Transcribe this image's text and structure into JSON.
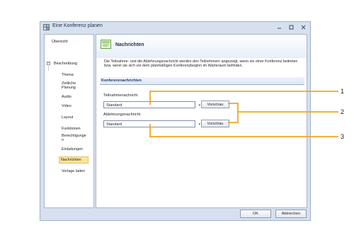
{
  "window": {
    "title": "Eine Konferenz planen"
  },
  "sidebar": {
    "items": [
      {
        "label": "Übersicht"
      },
      {
        "label": "Beschreibung"
      },
      {
        "label": "Thema"
      },
      {
        "label": "Zeitliche Planung"
      },
      {
        "label": "Audio"
      },
      {
        "label": "Video"
      },
      {
        "label": "Layout"
      },
      {
        "label": "Funktionen"
      },
      {
        "label": "Berechtigungen"
      },
      {
        "label": "Einladungen"
      },
      {
        "label": "Nachrichten"
      },
      {
        "label": "Vorlage laden"
      }
    ],
    "selected": "Nachrichten"
  },
  "panel": {
    "title": "Nachrichten",
    "description": "Die Teilnahme- und die Ablehnungsnachricht werden den Teilnehmern angezeigt, wenn sie einer Konferenz beitreten bzw. wenn sie sich vor dem planmäßigen Konferenzbeginn im Warteraum befinden.",
    "section_title": "Konferenznachrichten",
    "fields": [
      {
        "label": "Teilnahmenachricht",
        "value": "Standard",
        "button": "Vorschau"
      },
      {
        "label": "Ablehnungsnachricht",
        "value": "Standard",
        "button": "Vorschau"
      }
    ]
  },
  "footer": {
    "ok": "OK",
    "cancel": "Abbrechen"
  },
  "callouts": [
    "1",
    "2",
    "3"
  ],
  "colors": {
    "callout_line": "#f3a523",
    "accent": "#1f3c6e",
    "selected_bg": "#fce69c"
  },
  "icons": {
    "app": "conference-app-icon",
    "header": "message-icon"
  }
}
